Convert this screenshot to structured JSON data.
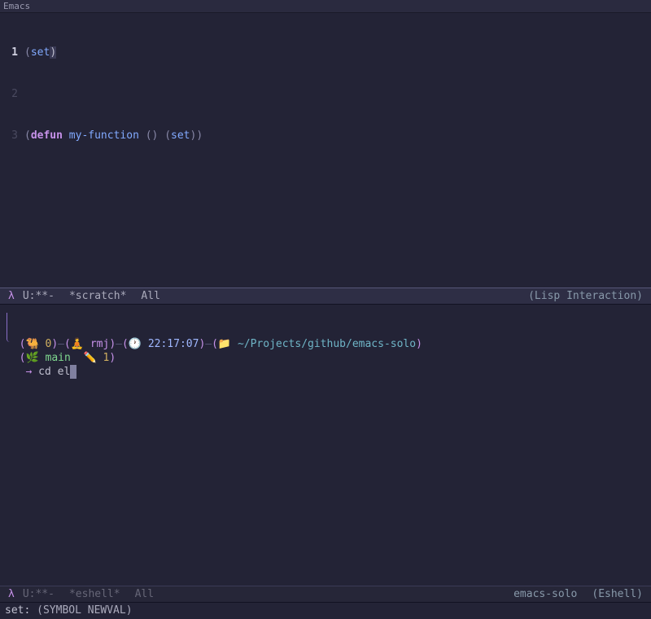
{
  "title": "Emacs",
  "top_buffer": {
    "lines": [
      {
        "num": "1",
        "current": true
      },
      {
        "num": "2"
      },
      {
        "num": "3"
      }
    ],
    "code": {
      "l1_open": "(",
      "l1_fn": "set",
      "l1_close": ")",
      "l3_open": "(",
      "l3_defun": "defun",
      "l3_name": "my-function",
      "l3_args": "()",
      "l3_inner_open": "(",
      "l3_inner_fn": "set",
      "l3_inner_close": ")",
      "l3_close": ")"
    }
  },
  "modeline_top": {
    "lambda": "λ",
    "status": "U:**-",
    "buffer": "*scratch*",
    "pos": "All",
    "mode": "(Lisp Interaction)"
  },
  "eshell": {
    "seg_exit_icon": "🐫",
    "seg_exit": "0",
    "seg_user_icon": "🧘",
    "seg_user": "rmj",
    "seg_time_icon": "🕐",
    "seg_time": "22:17:07",
    "seg_path_icon": "📁",
    "seg_path": "~/Projects/github/emacs-solo",
    "seg_branch_icon": "🌿",
    "seg_branch": "main",
    "seg_dirty_icon": "✏️",
    "seg_dirty": "1",
    "arrow": "→",
    "cmd": "cd el"
  },
  "modeline_bottom": {
    "lambda": "λ",
    "status": "U:**-",
    "buffer": "*eshell*",
    "pos": "All",
    "proj": "emacs-solo",
    "mode": "(Eshell)"
  },
  "minibuffer": {
    "fn": "set",
    "sig": "(SYMBOL NEWVAL)"
  }
}
